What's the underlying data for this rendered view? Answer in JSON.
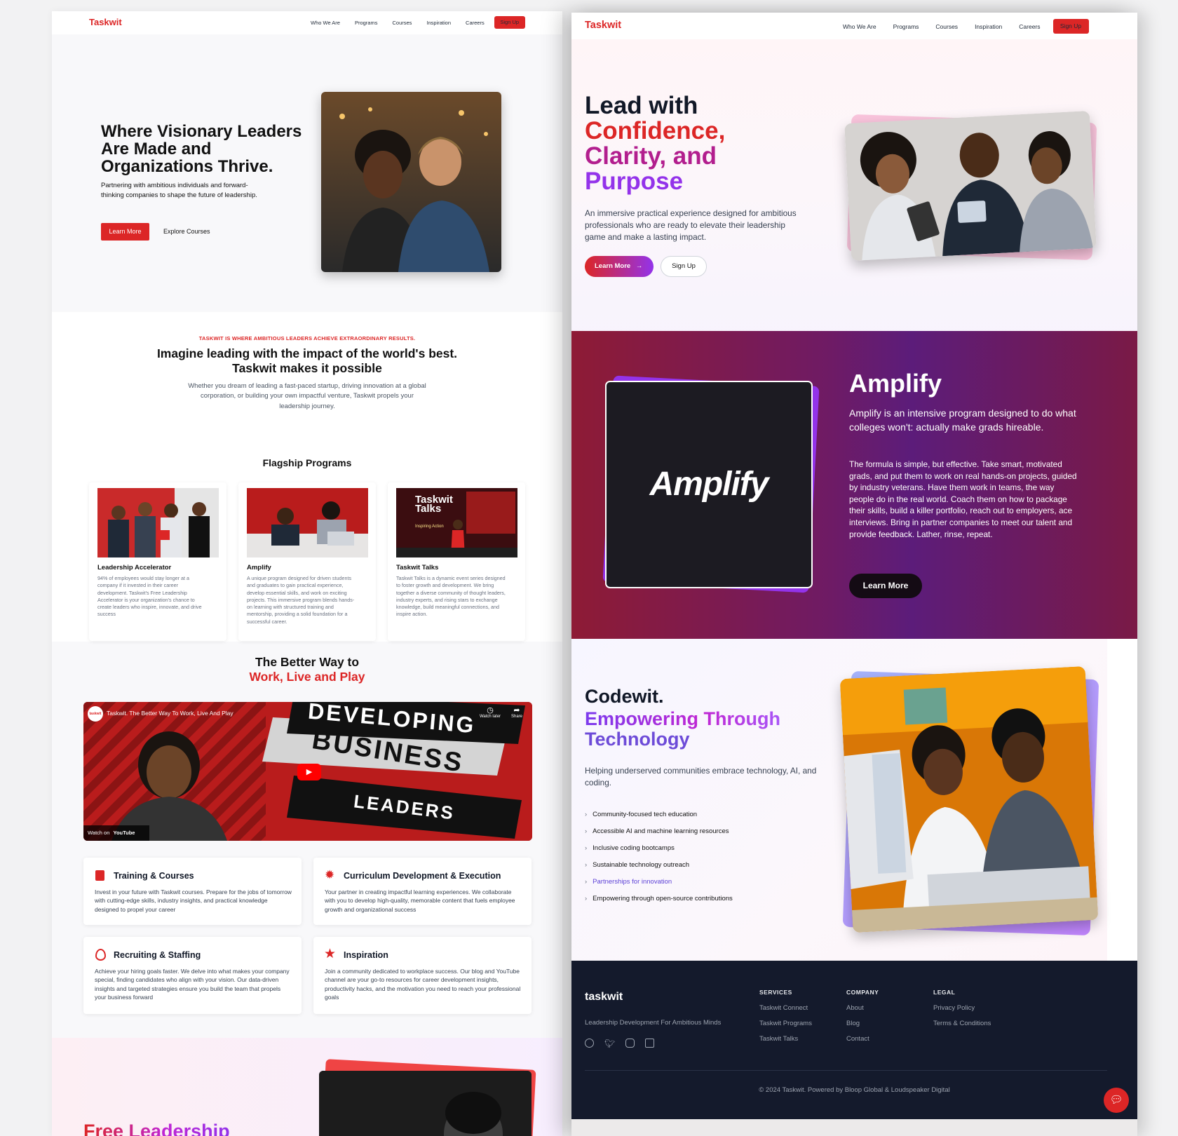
{
  "left": {
    "nav": {
      "brand": "Taskwit",
      "links": [
        "Who We Are",
        "Programs",
        "Courses",
        "Inspiration",
        "Careers"
      ],
      "signup": "Sign Up"
    },
    "hero": {
      "title": "Where Visionary Leaders Are Made and Organizations Thrive.",
      "subtitle": "Partnering with ambitious individuals and forward-thinking companies to shape the future of leadership.",
      "primary": "Learn More",
      "secondary": "Explore Courses"
    },
    "mission": {
      "eyebrow": "TASKWIT IS WHERE AMBITIOUS LEADERS ACHIEVE EXTRAORDINARY RESULTS.",
      "title_line1": "Imagine leading with the impact of the world's best.",
      "title_line2": "Taskwit makes it possible",
      "text": "Whether you dream of leading a fast-paced startup, driving innovation at a global corporation, or building your own impactful venture, Taskwit propels your leadership journey."
    },
    "flagship": {
      "title": "Flagship Programs",
      "cards": [
        {
          "title": "Leadership Accelerator",
          "text": "94% of employees would stay longer at a company if it invested in their career development. Taskwit's Free Leadership Accelerator is your organization's chance to create leaders who inspire, innovate, and drive success"
        },
        {
          "title": "Amplify",
          "text": "A unique program designed for driven students and graduates to gain practical experience, develop essential skills, and work on exciting projects. This immersive program blends hands-on learning with structured training and mentorship, providing a solid foundation for a successful career."
        },
        {
          "title": "Taskwit Talks",
          "text": "Taskwit Talks is a dynamic event series designed to foster growth and development. We bring together a diverse community of thought leaders, industry experts, and rising stars to exchange knowledge, build meaningful connections, and inspire action."
        }
      ],
      "talks_image_title": "Taskwit Talks",
      "talks_image_sub": "Inspiring Action"
    },
    "better": {
      "line1": "The Better Way to",
      "line2": "Work, Live and Play"
    },
    "video": {
      "title": "Taskwit. The Better Way To Work, Live And Play",
      "avatar": "taskwit",
      "watch_later": "Watch later",
      "share": "Share",
      "watch_on": "Watch on",
      "youtube": "YouTube",
      "banner1": "DEVELOPING",
      "banner2": "BUSINESS",
      "banner3": "LEADERS"
    },
    "services": [
      {
        "title": "Training & Courses",
        "text": "Invest in your future with Taskwit courses. Prepare for the jobs of tomorrow with cutting-edge skills, industry insights, and practical knowledge designed to propel your career"
      },
      {
        "title": "Curriculum Development & Execution",
        "text": "Your partner in creating impactful learning experiences. We collaborate with you to develop high-quality, memorable content that fuels employee growth and organizational success"
      },
      {
        "title": "Recruiting & Staffing",
        "text": "Achieve your hiring goals faster. We delve into what makes your company special, finding candidates who align with your vision. Our data-driven insights and targeted strategies ensure you build the team that propels your business forward"
      },
      {
        "title": "Inspiration",
        "text": "Join a community dedicated to workplace success. Our blog and YouTube channel are your go-to resources for career development insights, productivity hacks, and the motivation you need to reach your professional goals"
      }
    ],
    "bottom_title": "Free Leadership"
  },
  "right": {
    "nav": {
      "brand": "Taskwit",
      "links": [
        "Who We Are",
        "Programs",
        "Courses",
        "Inspiration",
        "Careers"
      ],
      "signup": "Sign Up"
    },
    "hero": {
      "line1": "Lead with",
      "line2": "Confidence,",
      "line3": "Clarity, and",
      "line4": "Purpose",
      "text": "An immersive practical experience designed for ambitious professionals who are ready to elevate their leadership game and make a lasting impact.",
      "primary": "Learn More",
      "secondary": "Sign Up"
    },
    "amplify": {
      "logo": "Amplify",
      "title": "Amplify",
      "lead": "Amplify is an intensive program designed to do what colleges won't: actually make grads hireable.",
      "text": "The formula is simple, but effective. Take smart, motivated grads, and put them to work on real hands-on projects, guided by industry veterans. Have them work in teams, the way people do in the real world. Coach them on how to package their skills, build a killer portfolio, reach out to employers, ace interviews. Bring in partner companies to meet our talent and provide feedback. Lather, rinse, repeat.",
      "button": "Learn More"
    },
    "codewit": {
      "title": "Codewit.",
      "sub1": "Empowering Through",
      "sub2": "Technology",
      "text": "Helping underserved communities embrace technology, AI, and coding.",
      "items": [
        "Community-focused tech education",
        "Accessible AI and machine learning resources",
        "Inclusive coding bootcamps",
        "Sustainable technology outreach",
        "Partnerships for innovation",
        "Empowering through open-source contributions"
      ]
    },
    "footer": {
      "logo": "taskwit",
      "tagline": "Leadership Development For Ambitious Minds",
      "columns": [
        {
          "heading": "SERVICES",
          "links": [
            "Taskwit Connect",
            "Taskwit Programs",
            "Taskwit Talks"
          ]
        },
        {
          "heading": "COMPANY",
          "links": [
            "About",
            "Blog",
            "Contact"
          ]
        },
        {
          "heading": "LEGAL",
          "links": [
            "Privacy Policy",
            "Terms & Conditions"
          ]
        }
      ],
      "copyright": "© 2024 Taskwit. Powered by Bloop Global & Loudspeaker Digital"
    }
  },
  "colors": {
    "brand_red": "#dc2626",
    "purple": "#9333ea",
    "navy": "#111827",
    "amplify_bg": "#7a1740"
  }
}
